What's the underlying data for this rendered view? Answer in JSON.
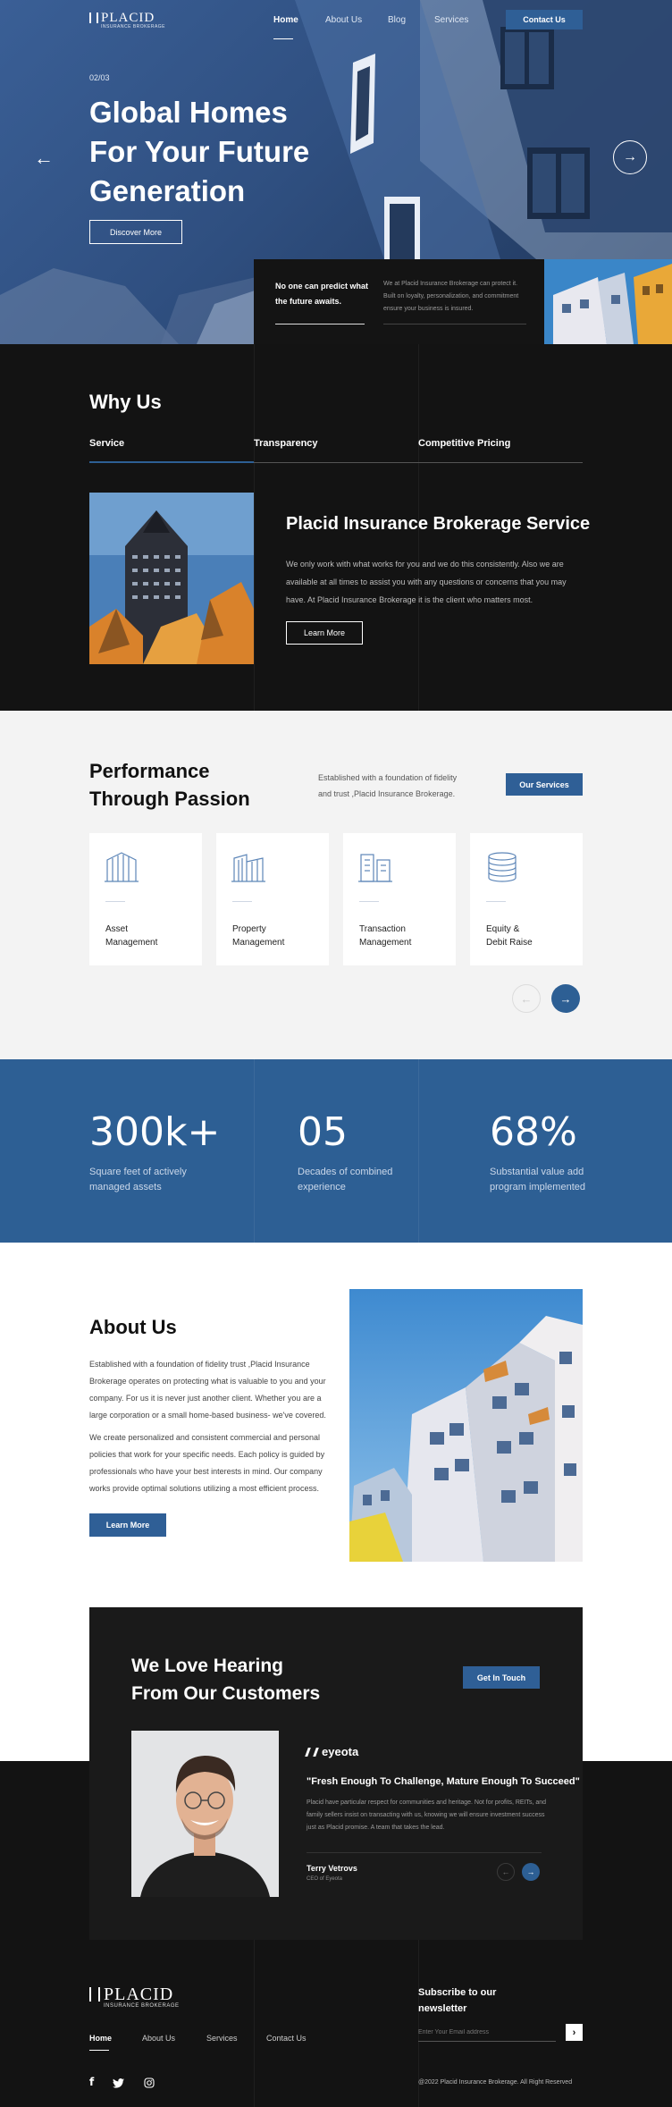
{
  "brand": {
    "name": "PLACID",
    "tagline": "INSURANCE BROKERAGE"
  },
  "nav": {
    "items": [
      "Home",
      "About Us",
      "Blog",
      "Services"
    ],
    "contact": "Contact Us"
  },
  "hero": {
    "counter": "02/03",
    "title_lines": [
      "Global Homes",
      "For Your Future",
      "Generation"
    ],
    "cta": "Discover More",
    "prev_arrow": "←",
    "next_arrow": "→",
    "card_heading_lines": [
      "No one can predict what",
      "the future awaits."
    ],
    "card_text_lines": [
      "We at Placid Insurance Brokerage can protect it.",
      "Built on loyalty, personalization, and commitment",
      "ensure your business is insured."
    ]
  },
  "why": {
    "title": "Why Us",
    "tabs": [
      "Service",
      "Transparency",
      "Competitive Pricing"
    ],
    "heading": "Placid Insurance Brokerage Service",
    "text_lines": [
      "We only work with what works for you and we do this consistently. Also we are",
      "available at all times to assist you with any questions or concerns that you may",
      "have. At Placid Insurance Brokerage it is the client who matters most."
    ],
    "button": "Learn More"
  },
  "performance": {
    "title_lines": [
      "Performance",
      "Through Passion"
    ],
    "text_lines": [
      "Established with a foundation of fidelity",
      "and trust ,Placid Insurance Brokerage."
    ],
    "button": "Our Services",
    "cards": [
      {
        "line1": "Asset",
        "line2": "Management",
        "icon": "building-icon"
      },
      {
        "line1": "Property",
        "line2": "Management",
        "icon": "property-icon"
      },
      {
        "line1": "Transaction",
        "line2": "Management",
        "icon": "transaction-icon"
      },
      {
        "line1": "Equity &",
        "line2": "Debit Raise",
        "icon": "coins-icon"
      }
    ],
    "prev": "←",
    "next": "→"
  },
  "stats": [
    {
      "value": "300k+",
      "line1": "Square feet of actively",
      "line2": "managed assets"
    },
    {
      "value": "05",
      "line1": "Decades of combined",
      "line2": "experience"
    },
    {
      "value": "68%",
      "line1": "Substantial value add",
      "line2": "program implemented"
    }
  ],
  "about": {
    "title": "About Us",
    "p1_lines": [
      "Established with a foundation of fidelity trust ,Placid Insurance",
      "Brokerage operates on protecting what is valuable to you and your",
      "company. For us it is never just another client. Whether you are a",
      "large corporation or a small home-based business- we've covered."
    ],
    "p2_lines": [
      "We create personalized and consistent commercial and personal",
      "policies that work for your specific needs. Each policy is guided by",
      "professionals who have your best interests in mind. Our company",
      "works provide optimal solutions utilizing a most efficient process."
    ],
    "button": "Learn More"
  },
  "testimonial": {
    "title_lines": [
      "We Love Hearing",
      "From Our Customers"
    ],
    "button": "Get In Touch",
    "company": "eyeota",
    "quote": "\"Fresh Enough To Challenge, Mature Enough To Succeed\"",
    "text_lines": [
      "Placid have particular respect for communities and heritage. Not for profits, REITs, and",
      "family sellers insist on transacting with us, knowing we will ensure investment success",
      "just as Placid promise. A team that takes the lead."
    ],
    "name": "Terry Vetrovs",
    "role": "CEO of Eyeota",
    "prev": "←",
    "next": "→"
  },
  "footer": {
    "links": [
      "Home",
      "About Us",
      "Services",
      "Contact Us"
    ],
    "newsletter_lines": [
      "Subscribe to our",
      "newsletter"
    ],
    "email_placeholder": "Enter Your Email address",
    "submit": "›",
    "copyright": "@2022 Placid Insurance Brokerage. All Right Reserved",
    "social": [
      "facebook-icon",
      "twitter-icon",
      "instagram-icon"
    ]
  },
  "colors": {
    "accent": "#2d5f94",
    "dark": "#131313",
    "light": "#f3f3f3"
  }
}
